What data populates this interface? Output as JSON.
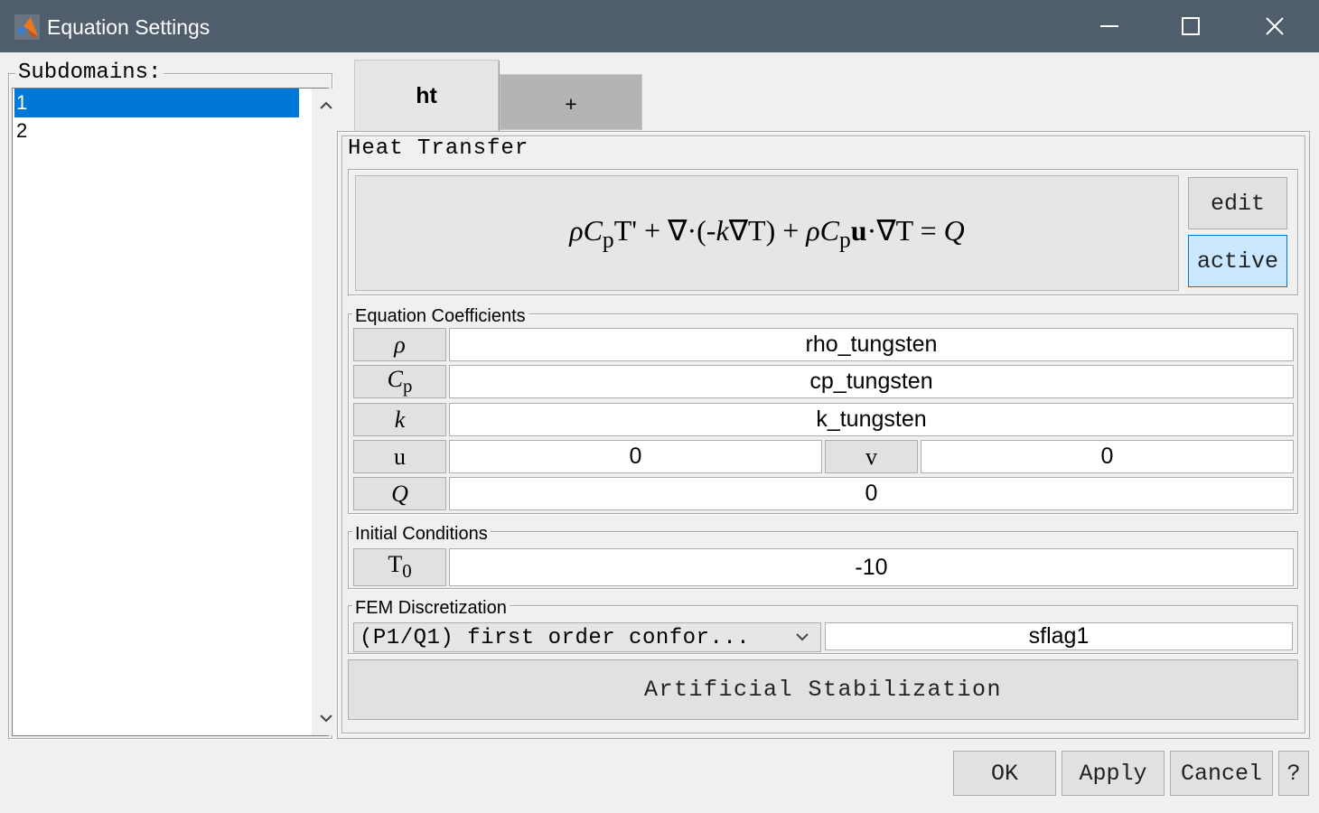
{
  "window": {
    "title": "Equation Settings",
    "minimize_icon": "minimize-icon",
    "maximize_icon": "maximize-icon",
    "close_icon": "close-icon"
  },
  "subdomains": {
    "label": "Subdomains:",
    "items": [
      "1",
      "2"
    ],
    "selected": "1"
  },
  "tabs": [
    {
      "label": "ht",
      "active": true
    },
    {
      "label": "+",
      "active": false
    }
  ],
  "heat_transfer": {
    "group_label": "Heat Transfer",
    "equation": {
      "rho": "ρ",
      "C": "C",
      "p": "p",
      "T": "T'",
      "plus1": " + ",
      "nabla_dot": "∇·(-",
      "k": "k",
      "nabla_T": "∇T)",
      "plus2": " + ",
      "rho2": "ρ",
      "C2": "C",
      "p2": "p",
      "u": "u",
      "dot_nabla_T": "·∇T = ",
      "Q": "Q"
    },
    "edit_button": "edit",
    "active_button": "active",
    "colors": {
      "active_bg": "#cce8ff",
      "active_border": "#0078d7"
    }
  },
  "coefficients": {
    "group_label": "Equation Coefficients",
    "rho": {
      "label": "ρ",
      "value": "rho_tungsten"
    },
    "cp": {
      "label": "C",
      "sub": "p",
      "value": "cp_tungsten"
    },
    "k": {
      "label": "k",
      "value": "k_tungsten"
    },
    "u": {
      "label": "u",
      "value": "0"
    },
    "v": {
      "label": "v",
      "value": "0"
    },
    "Q": {
      "label": "Q",
      "value": "0"
    }
  },
  "initial_conditions": {
    "group_label": "Initial Conditions",
    "T0": {
      "label": "T",
      "sub": "0",
      "value": "-10"
    }
  },
  "fem": {
    "group_label": "FEM Discretization",
    "selected_option": "(P1/Q1) first order confor...",
    "sflag": "sflag1",
    "dropdown_icon": "chevron-down-icon"
  },
  "artificial_stabilization": "Artificial Stabilization",
  "footer": {
    "ok": "OK",
    "apply": "Apply",
    "cancel": "Cancel",
    "help": "?"
  },
  "colors": {
    "titlebar": "#4f5d6c",
    "selection": "#0078d7",
    "dialog_bg": "#f0f0f0"
  }
}
